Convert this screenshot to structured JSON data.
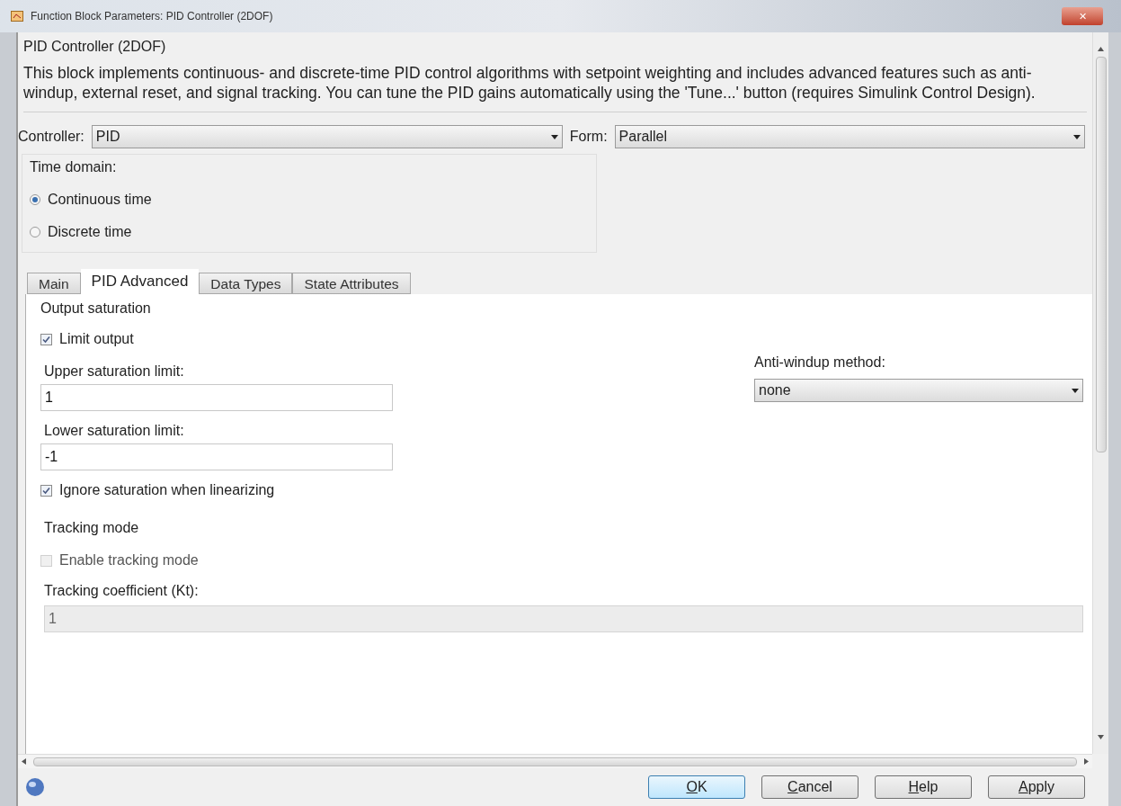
{
  "window": {
    "title": "Function Block Parameters: PID Controller (2DOF)",
    "close": "✕"
  },
  "block": {
    "title": "PID Controller (2DOF)",
    "description": "This block implements continuous- and discrete-time PID control algorithms with setpoint weighting and includes advanced features such as anti-windup, external reset, and signal tracking. You can tune the PID gains automatically using the 'Tune...' button (requires Simulink Control Design)."
  },
  "controller": {
    "label": "Controller:",
    "value": "PID"
  },
  "form": {
    "label": "Form:",
    "value": "Parallel"
  },
  "time_domain": {
    "title": "Time domain:",
    "options": [
      {
        "label": "Continuous time",
        "selected": true
      },
      {
        "label": "Discrete time",
        "selected": false
      }
    ]
  },
  "tabs": [
    {
      "label": "Main",
      "selected": false
    },
    {
      "label": "PID Advanced",
      "selected": true
    },
    {
      "label": "Data Types",
      "selected": false
    },
    {
      "label": "State Attributes",
      "selected": false
    }
  ],
  "advanced": {
    "output_saturation": "Output saturation",
    "limit_output": {
      "label": "Limit output",
      "checked": true
    },
    "upper": {
      "label": "Upper saturation limit:",
      "value": "1"
    },
    "lower": {
      "label": "Lower saturation limit:",
      "value": "-1"
    },
    "ignore": {
      "label": "Ignore saturation when linearizing",
      "checked": true
    },
    "anti_windup": {
      "label": "Anti-windup method:",
      "value": "none"
    },
    "tracking_mode": "Tracking mode",
    "enable_tracking": {
      "label": "Enable tracking mode",
      "checked": false,
      "disabled": true
    },
    "tracking_coefficient": {
      "label": "Tracking coefficient (Kt):",
      "value": "1",
      "disabled": true
    }
  },
  "buttons": [
    {
      "label": "OK",
      "kind": "default"
    },
    {
      "label": "Cancel",
      "kind": "normal"
    },
    {
      "label": "Help",
      "kind": "normal"
    },
    {
      "label": "Apply",
      "kind": "normal"
    }
  ]
}
